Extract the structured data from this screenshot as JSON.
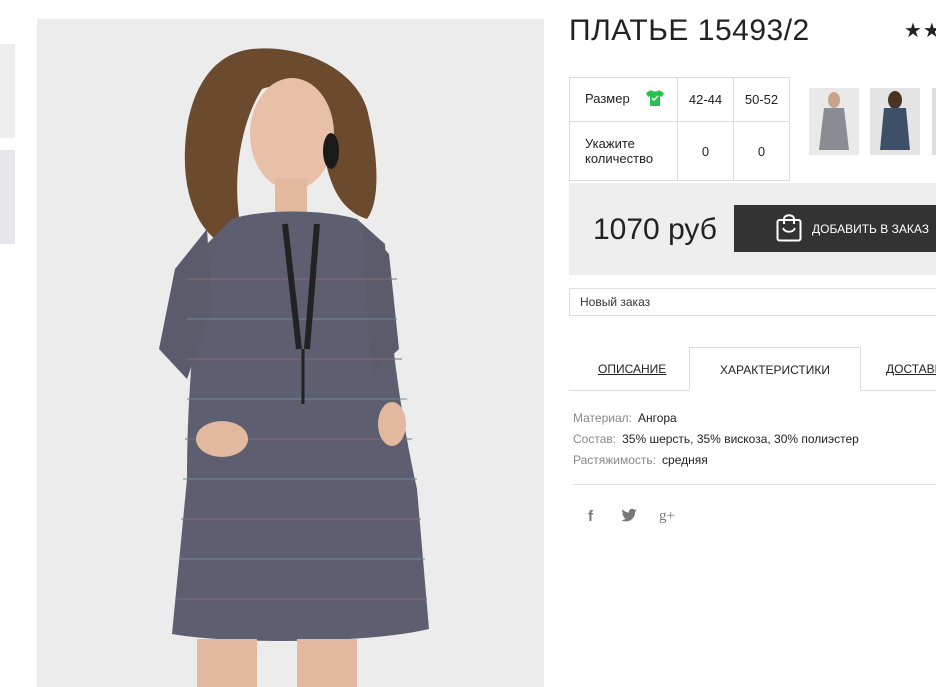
{
  "product": {
    "title": "ПЛАТЬЕ 15493/2",
    "rating_stars": "★★"
  },
  "sizes": {
    "size_label": "Размер",
    "size_icon": "tshirt-icon",
    "size_icon_color": "#27c24c",
    "options": [
      "42-44",
      "50-52"
    ],
    "qty_label": "Укажите количество",
    "quantities": [
      "0",
      "0"
    ]
  },
  "price": {
    "value": "1070 руб",
    "add_button_label": "ДОБАВИТЬ В ЗАКАЗ",
    "button_color": "#333333"
  },
  "order": {
    "selected": "Новый заказ"
  },
  "tabs": {
    "description": "ОПИСАНИЕ",
    "characteristics": "ХАРАКТЕРИСТИКИ",
    "delivery": "ДОСТАВКА"
  },
  "specs": [
    {
      "key": "Материал:",
      "value": "Ангора"
    },
    {
      "key": "Состав:",
      "value": "35% шерсть, 35% вискоза, 30% полиэстер"
    },
    {
      "key": "Растяжимость:",
      "value": "средняя"
    }
  ],
  "social": {
    "facebook": "f",
    "twitter": "🐦",
    "googleplus": "g+"
  }
}
